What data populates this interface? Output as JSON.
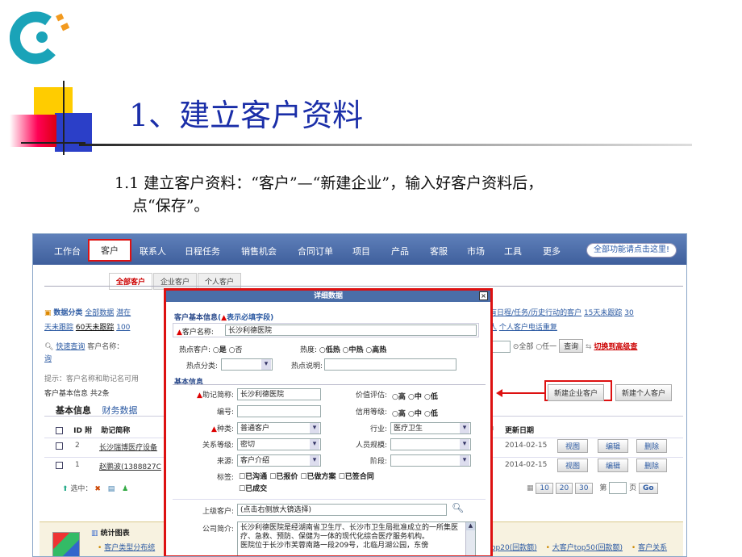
{
  "slide": {
    "title": "1、建立客户资料",
    "subtitle_line1": "1.1 建立客户资料：“客户”—“新建企业”，输入好客户资料后，",
    "subtitle_line2": "点“保存”。"
  },
  "colors": {
    "accent_red": "#dd1111",
    "nav_blue": "#4a6ea8",
    "logo_teal": "#1aa3b8",
    "logo_orange": "#f29a1f"
  },
  "nav": {
    "items": [
      "工作台",
      "客户",
      "联系人",
      "日程任务",
      "销售机会",
      "合同订单",
      "项目",
      "产品",
      "客服",
      "市场",
      "工具",
      "更多"
    ],
    "active": "客户",
    "all_functions": "全部功能请点击这里!"
  },
  "tabs": [
    "全部客户",
    "企业客户",
    "个人客户"
  ],
  "filters": {
    "category_label": "数据分类",
    "line1_items": [
      "全部数据",
      "潜在"
    ],
    "line2_items": [
      "天未跟踪",
      "60天未跟踪",
      "100"
    ],
    "right_line1": "有日程/任务/历史行动的客户",
    "right_line1_items": [
      "15天未跟踪",
      "30"
    ],
    "right_line2_prefix": "人",
    "right_line2": "个人客户电话重复",
    "quick_search_label": "快速查询",
    "quick_search_field": "客户名称：",
    "quick_search_second_line": "询",
    "radio_all": "全部",
    "radio_any": "任一",
    "search_button": "查询",
    "advanced_link": "切换到高级查"
  },
  "hint": "提示：客户名称和助记名可用",
  "count_text": "客户基本信息 共2条",
  "sub_tabs": [
    "基本信息",
    "财务数据"
  ],
  "buttons": {
    "new_company": "新建企业客户",
    "new_person": "新建个人客户"
  },
  "table": {
    "headers": [
      "ID",
      "附",
      "助记简称",
      "更新日期"
    ],
    "rows": [
      {
        "id": "2",
        "name": "长沙瑞博医疗设备",
        "date": "2014-02-15",
        "actions": [
          "视图",
          "编辑",
          "删除"
        ]
      },
      {
        "id": "1",
        "name": "赵鹏波(1388827C",
        "date": "2014-02-15",
        "actions": [
          "视图",
          "编辑",
          "删除"
        ]
      }
    ],
    "selected_label": "选中：",
    "page_sizes": [
      "10",
      "20",
      "30"
    ],
    "page_prefix": "第",
    "page_suffix": "页",
    "go_button": "Go"
  },
  "stats": {
    "title": "统计图表",
    "left_link": "客户类型分布统",
    "right_links": [
      "op20(回款额)",
      "大客户top50(回款额)",
      "客户关系"
    ]
  },
  "modal": {
    "title": "详细数据",
    "close": "×",
    "section1": "客户基本信息",
    "section1_note_open": "(",
    "section1_note_mark": "▲",
    "section1_note_text": "表示必填字段)",
    "name_label": "客户名称:",
    "name_value": "长沙利德医院",
    "hot_label": "热点客户:",
    "hot_yes": "是",
    "hot_no": "否",
    "heat_label": "热度:",
    "heat_options": [
      "低热",
      "中热",
      "高热"
    ],
    "hot_cat_label": "热点分类:",
    "hot_note_label": "热点说明:",
    "section2": "基本信息",
    "alias_label": "助记简称:",
    "alias_value": "长沙利德医院",
    "value_eval_label": "价值评估:",
    "level_options": [
      "高",
      "中",
      "低"
    ],
    "code_label": "编号:",
    "credit_label": "信用等级:",
    "type_label": "种类:",
    "type_value": "普通客户",
    "industry_label": "行业:",
    "industry_value": "医疗卫生",
    "relation_label": "关系等级:",
    "relation_value": "密切",
    "staff_label": "人员规模:",
    "source_label": "来源:",
    "source_value": "客户介绍",
    "stage_label": "阶段:",
    "tags_label": "标签:",
    "tags": [
      "已沟通",
      "已报价",
      "已做方案",
      "已签合同",
      "已成交"
    ],
    "parent_label": "上级客户:",
    "parent_value": "(点击右侧放大镜选择)",
    "intro_label": "公司简介:",
    "intro_value": "长沙利德医院是经湖南省卫生厅、长沙市卫生局批准成立的一所集医疗、急救、预防、保健为一体的现代化综合医疗服务机构。",
    "intro_value2": "医院位于长沙市芙蓉南路一段209号，北临月湖公园，东傍"
  }
}
